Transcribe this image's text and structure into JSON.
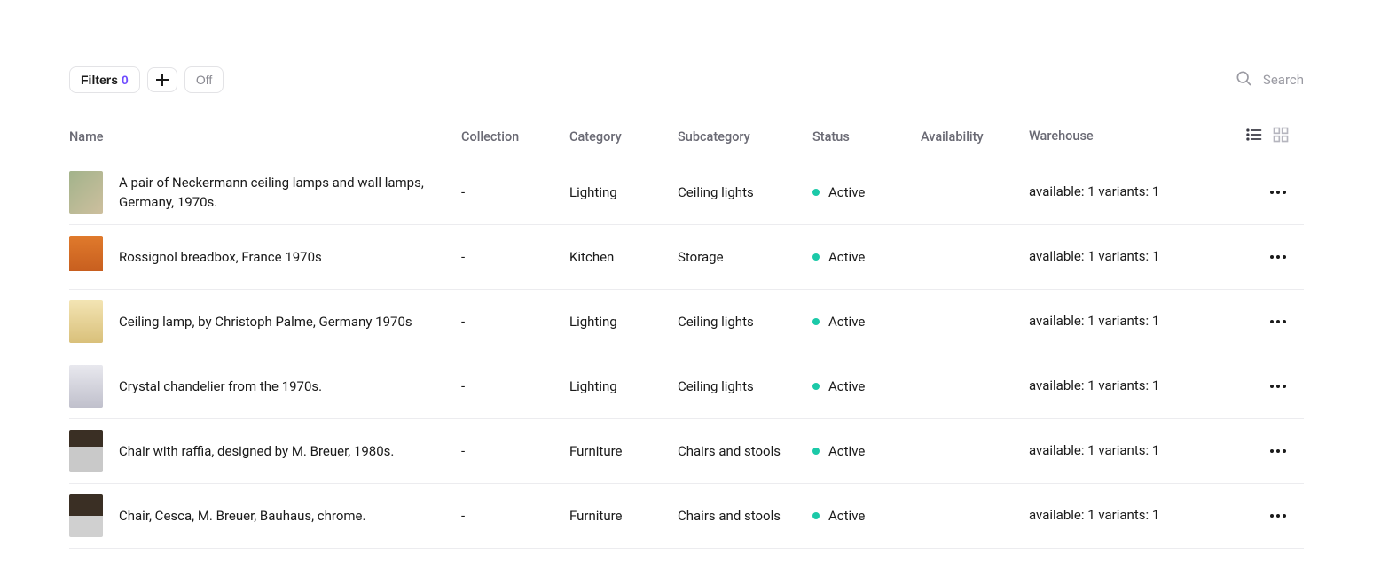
{
  "toolbar": {
    "filters_label": "Filters",
    "filters_count": "0",
    "off_label": "Off",
    "search_placeholder": "Search"
  },
  "columns": {
    "name": "Name",
    "collection": "Collection",
    "category": "Category",
    "subcategory": "Subcategory",
    "status": "Status",
    "availability": "Availability",
    "warehouse": "Warehouse"
  },
  "status_colors": {
    "active": "#1bc9a8"
  },
  "accent_color": "#6f4cff",
  "rows": [
    {
      "name": "A pair of Neckermann ceiling lamps and wall lamps, Germany, 1970s.",
      "collection": "-",
      "category": "Lighting",
      "subcategory": "Ceiling lights",
      "status": "Active",
      "availability": "",
      "warehouse": "available: 1 variants: 1",
      "thumb_class": "t1"
    },
    {
      "name": "Rossignol breadbox, France 1970s",
      "collection": "-",
      "category": "Kitchen",
      "subcategory": "Storage",
      "status": "Active",
      "availability": "",
      "warehouse": "available: 1 variants: 1",
      "thumb_class": "t2"
    },
    {
      "name": "Ceiling lamp, by Christoph Palme, Germany 1970s",
      "collection": "-",
      "category": "Lighting",
      "subcategory": "Ceiling lights",
      "status": "Active",
      "availability": "",
      "warehouse": "available: 1 variants: 1",
      "thumb_class": "t3"
    },
    {
      "name": "Crystal chandelier from the 1970s.",
      "collection": "-",
      "category": "Lighting",
      "subcategory": "Ceiling lights",
      "status": "Active",
      "availability": "",
      "warehouse": "available: 1 variants: 1",
      "thumb_class": "t4"
    },
    {
      "name": "Chair with raffia, designed by M. Breuer, 1980s.",
      "collection": "-",
      "category": "Furniture",
      "subcategory": "Chairs and stools",
      "status": "Active",
      "availability": "",
      "warehouse": "available: 1 variants: 1",
      "thumb_class": "t5"
    },
    {
      "name": "Chair, Cesca, M. Breuer, Bauhaus, chrome.",
      "collection": "-",
      "category": "Furniture",
      "subcategory": "Chairs and stools",
      "status": "Active",
      "availability": "",
      "warehouse": "available: 1 variants: 1",
      "thumb_class": "t6"
    }
  ]
}
